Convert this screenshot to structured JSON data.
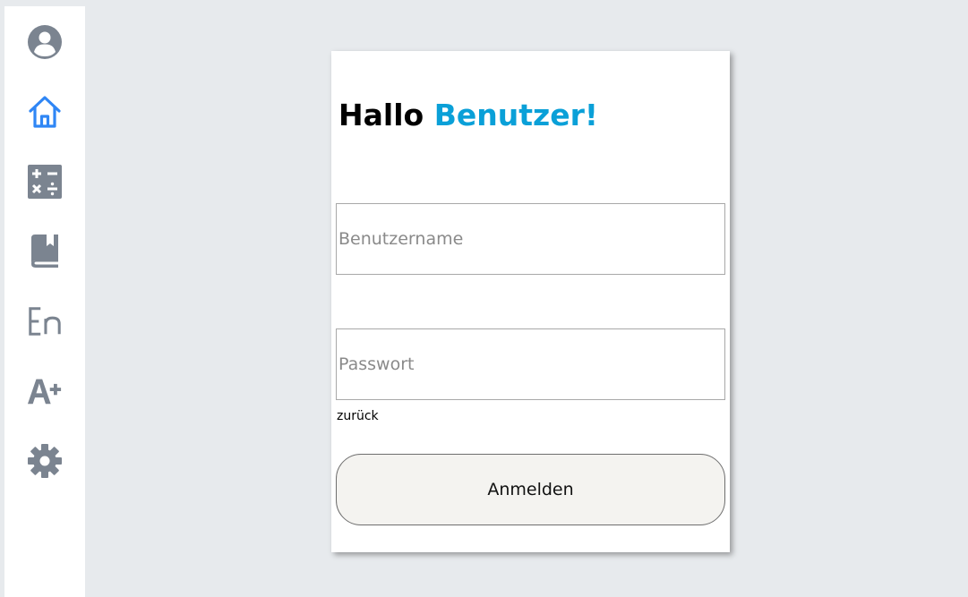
{
  "sidebar": {
    "items": [
      {
        "icon": "user-profile-icon",
        "color": "#7b8490"
      },
      {
        "icon": "home-icon",
        "color": "#2f86f5",
        "active": true
      },
      {
        "icon": "calculator-icon",
        "color": "#7b8490"
      },
      {
        "icon": "book-icon",
        "color": "#7b8490"
      },
      {
        "icon": "language-icon",
        "label": "En",
        "color": "#7b8490"
      },
      {
        "icon": "font-size-increase-icon",
        "label": "A+",
        "color": "#7b8490"
      },
      {
        "icon": "settings-gear-icon",
        "color": "#7b8490"
      }
    ]
  },
  "login": {
    "greeting": "Hallo",
    "greeting_name": "Benutzer!",
    "accent_color": "#0aa0d8",
    "username_placeholder": "Benutzername",
    "password_placeholder": "Passwort",
    "back_label": "zurück",
    "submit_label": "Anmelden"
  }
}
